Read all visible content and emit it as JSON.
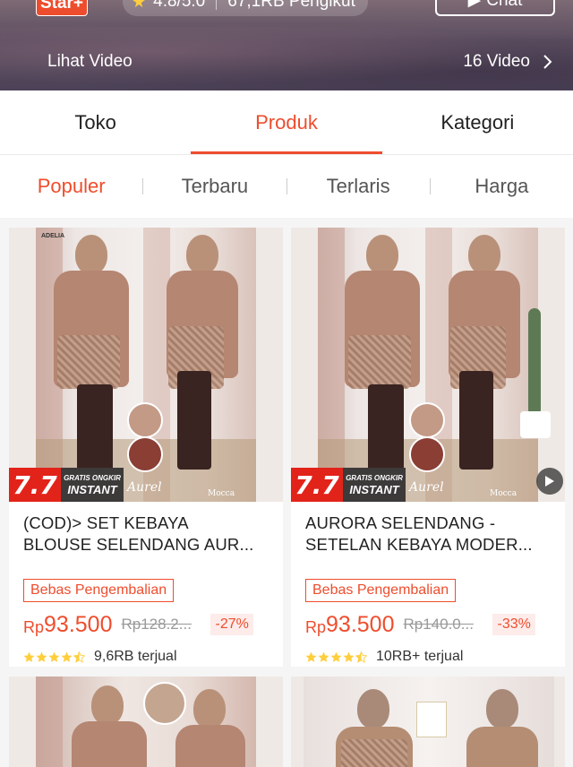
{
  "shop": {
    "badge": "Star+",
    "rating": "4.8/5.0",
    "followers": "67,1RB Pengikut",
    "chat_label": "Chat",
    "video_link": "Lihat Video",
    "video_count": "16 Video"
  },
  "tabs": [
    {
      "label": "Toko",
      "active": false
    },
    {
      "label": "Produk",
      "active": true
    },
    {
      "label": "Kategori",
      "active": false
    }
  ],
  "sort": [
    {
      "label": "Populer",
      "active": true
    },
    {
      "label": "Terbaru",
      "active": false
    },
    {
      "label": "Terlaris",
      "active": false
    },
    {
      "label": "Harga",
      "active": false
    }
  ],
  "products": [
    {
      "title_line1": "(COD)> SET KEBAYA",
      "title_line2": "BLOUSE SELENDANG AUR...",
      "return_badge": "Bebas Pengembalian",
      "currency": "Rp",
      "price": "93.500",
      "original_price": "Rp128.2...",
      "discount": "-27%",
      "rating_stars": 4.5,
      "sold": "9,6RB terjual",
      "promo": "7.7",
      "promo_line1": "GRATIS ONGKIR",
      "promo_line2": "INSTANT",
      "brand": "Aurel",
      "color_name": "Mocca",
      "logo": "ADELIA",
      "has_video": false
    },
    {
      "title_line1": "AURORA SELENDANG -",
      "title_line2": "SETELAN KEBAYA MODER...",
      "return_badge": "Bebas Pengembalian",
      "currency": "Rp",
      "price": "93.500",
      "original_price": "Rp140.0...",
      "discount": "-33%",
      "rating_stars": 4.5,
      "sold": "10RB+ terjual",
      "promo": "7.7",
      "promo_line1": "GRATIS ONGKIR",
      "promo_line2": "INSTANT",
      "brand": "Aurel",
      "color_name": "Mocca",
      "has_video": true
    }
  ],
  "colors": {
    "accent": "#ee4d2d",
    "promo_red": "#e2231a",
    "star_yellow": "#ffce3d"
  }
}
